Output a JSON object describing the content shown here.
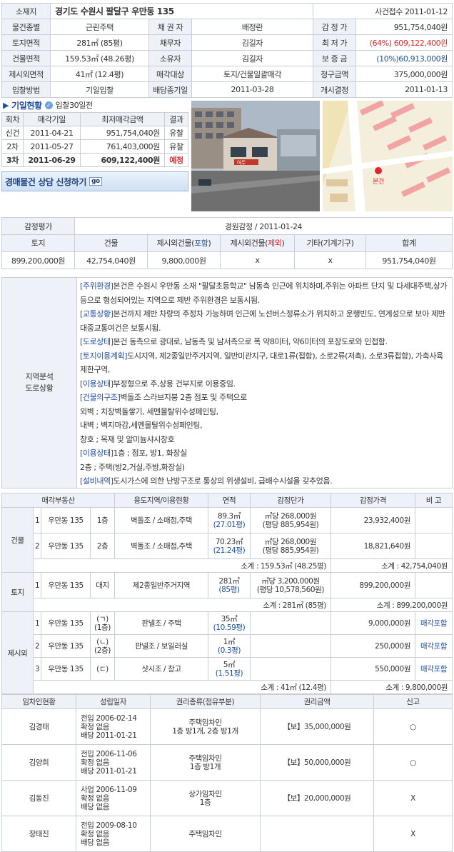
{
  "summary": {
    "address_label": "소재지",
    "address": "경기도 수원시 팔달구 우만동 135",
    "case_receipt": "사건접수 2011-01-12",
    "rows": [
      [
        "물건종별",
        "근린주택",
        "채 권 자",
        "배정란",
        "감 정 가",
        "951,754,040원"
      ],
      [
        "토지면적",
        "281㎡ (85평)",
        "채무자",
        "김길자",
        "최 저 가",
        "(64%) 609,122,400원"
      ],
      [
        "건물면적",
        "159.53㎡ (48.26평)",
        "소유자",
        "김길자",
        "보 증 금",
        "(10%)60,913,000원"
      ],
      [
        "제시외면적",
        "41㎡ (12.4평)",
        "매각대상",
        "토지/건물일괄매각",
        "청구금액",
        "375,000,000원"
      ],
      [
        "입찰방법",
        "기일입찰",
        "배당종기일",
        "2011-03-28",
        "개시결정",
        "2011-01-13"
      ]
    ]
  },
  "history": {
    "tab": "기일현황",
    "dday": "입찰30일전",
    "headers": [
      "회차",
      "매각기일",
      "최저매각금액",
      "결과"
    ],
    "rows": [
      [
        "신건",
        "2011-04-21",
        "951,754,040원",
        "유찰"
      ],
      [
        "2차",
        "2011-05-27",
        "761,403,000원",
        "유찰"
      ],
      [
        "3차",
        "2011-06-29",
        "609,122,400원",
        "예정"
      ]
    ]
  },
  "consult": {
    "label": "경매물건 상담 신청하기",
    "go": "go"
  },
  "photo": {
    "sign": "아두"
  },
  "map": {
    "pin_label": "본건"
  },
  "appraisal": {
    "title": "감정평가",
    "org": "경원감정 / 2011-01-24",
    "headers": [
      "토지",
      "건물",
      "제시외건물(포함)",
      "제시외건물(제외)",
      "기타(기계기구)",
      "합계"
    ],
    "values": [
      "899,200,000원",
      "42,754,040원",
      "9,800,000원",
      "x",
      "x",
      "951,754,040원"
    ]
  },
  "analysis": {
    "label1": "지역분석",
    "label2": "도로상황",
    "items": [
      {
        "tag": "[주위환경]",
        "text": "본건은 수원시 우만동 소재 \"팔달초등학교\" 남동측 인근에 위치하며,주위는 아파트 단지 및 다세대주택,상가 등으로 형성되어있는 지역으로 제반 주위환경은 보통시됨."
      },
      {
        "tag": "[교통상황]",
        "text": "본건까지 제반 차량의 주정차 가능하며 인근에 노선버스정류소가 위치하고 운행빈도, 연계성으로 보아 제반 대중교통여건은 보통시됨."
      },
      {
        "tag": "[도로상태]",
        "text": "본건 동측으로 광대로, 남동측 및 남서측으로 폭 약8미터, 약6미터의 포장도로와 인접함."
      },
      {
        "tag": "[토지이용계획]",
        "text": "도시지역, 제2종일반주거지역, 일반미관지구, 대로1류(접함), 소로2류(저촉), 소로3류접함), 가축사육제한구역,"
      },
      {
        "tag": "[이용상태]",
        "text": "부정형으로 주,상용 건부지로 이용중임."
      },
      {
        "tag": "[건물의구조]",
        "text": "벽돌조 스라브지붕 2층 점포 및 주택으로"
      },
      {
        "tag": "",
        "text": "외벽 ; 치장벽돌쌓기, 세멘몰탈위수성페인팅,"
      },
      {
        "tag": "",
        "text": "내벽 ; 벽지마감,세멘몰탈위수성페인팅,"
      },
      {
        "tag": "",
        "text": "창호 ; 목재 및 알미늄샤시창호"
      },
      {
        "tag": "[이용상태]",
        "text": "1층 ; 점포, 방1, 화장실"
      },
      {
        "tag": "",
        "text": "2층 ; 주택(방2,거실,주방,화장실)"
      },
      {
        "tag": "[설비내역]",
        "text": "도시가스에 의한 난방구조로 통상의 위생설비, 급배수시설을 갖추었음."
      }
    ]
  },
  "property": {
    "headers": [
      "매각부동산",
      "용도지역/이용현황",
      "면적",
      "감정단가",
      "감정가격",
      "비 고"
    ],
    "building": {
      "label": "건물",
      "rows": [
        {
          "no": "1",
          "addr": "우만동 135",
          "floor": "1층",
          "use": "벽돌조 / 소매점,주택",
          "area": "89.3㎡",
          "area2": "(27.01평)",
          "unit1": "㎡당 268,000원",
          "unit2": "(평당 885,954원)",
          "price": "23,932,400원",
          "note": ""
        },
        {
          "no": "2",
          "addr": "우만동 135",
          "floor": "2층",
          "use": "벽돌조 / 소매점,주택",
          "area": "70.23㎡",
          "area2": "(21.24평)",
          "unit1": "㎡당 268,000원",
          "unit2": "(평당 885,954원)",
          "price": "18,821,640원",
          "note": ""
        }
      ],
      "sub_area": "소계 : 159.53㎡ (48.25평)",
      "sub_price": "소계 : 42,754,040원"
    },
    "land": {
      "label": "토지",
      "rows": [
        {
          "no": "1",
          "addr": "우만동 135",
          "floor": "대지",
          "use": "제2종일반주거지역",
          "area": "281㎡",
          "area2": "(85평)",
          "unit1": "㎡당 3,200,000원",
          "unit2": "(평당 10,578,560원)",
          "price": "899,200,000원",
          "note": ""
        }
      ],
      "sub_area": "소계 : 281㎡ (85평)",
      "sub_price": "소계 : 899,200,000원"
    },
    "extra": {
      "label": "제시외",
      "rows": [
        {
          "no": "1",
          "addr": "우만동 135",
          "floor": "(ㄱ)",
          "floor2": "(1층)",
          "use": "판넬조 / 주택",
          "area": "35㎡",
          "area2": "(10.59평)",
          "price": "9,000,000원",
          "note": "매각포함"
        },
        {
          "no": "2",
          "addr": "우만동 135",
          "floor": "(ㄴ)",
          "floor2": "(2층)",
          "use": "판넬조 / 보일러실",
          "area": "1㎡",
          "area2": "(0.3평)",
          "price": "250,000원",
          "note": "매각포함"
        },
        {
          "no": "3",
          "addr": "우만동 135",
          "floor": "(ㄷ)",
          "floor2": "",
          "use": "샷시조 / 창고",
          "area": "5㎡",
          "area2": "(1.51평)",
          "price": "550,000원",
          "note": "매각포함"
        }
      ],
      "sub_area": "소계 : 41㎡ (12.4평)",
      "sub_price": "소계 : 9,800,000원"
    }
  },
  "tenants": {
    "headers": [
      "임차인현황",
      "성립일자",
      "권리종류(점유부분)",
      "권리금액",
      "신고"
    ],
    "rows": [
      {
        "name": "김경태",
        "d1": "전입 2006-02-14",
        "d2": "확정 없음",
        "d3": "배당 2011-01-21",
        "r1": "주택임차인",
        "r2": "1층 방1개, 2층 방1개",
        "amount": "【보】35,000,000원",
        "report": "○"
      },
      {
        "name": "김양희",
        "d1": "전입 2006-11-06",
        "d2": "확정 없음",
        "d3": "배당 2011-01-21",
        "r1": "주택임차인",
        "r2": "1층 방1개",
        "amount": "【보】50,000,000원",
        "report": "○"
      },
      {
        "name": "김동진",
        "d1": "사업 2006-11-09",
        "d2": "확정 없음",
        "d3": "배당 없음",
        "r1": "상가임차인",
        "r2": "1층",
        "amount": "【보】20,000,000원",
        "report": "X"
      },
      {
        "name": "장태진",
        "d1": "전입 2009-08-10",
        "d2": "확정 없음",
        "d3": "배당 없음",
        "r1": "주택임차인",
        "r2": "",
        "amount": "",
        "report": "X"
      }
    ]
  },
  "colors": {
    "label_bg": "#eef1f7",
    "border": "#c9ced6",
    "accent_blue": "#1f4fa1",
    "accent_red": "#e0262a"
  }
}
